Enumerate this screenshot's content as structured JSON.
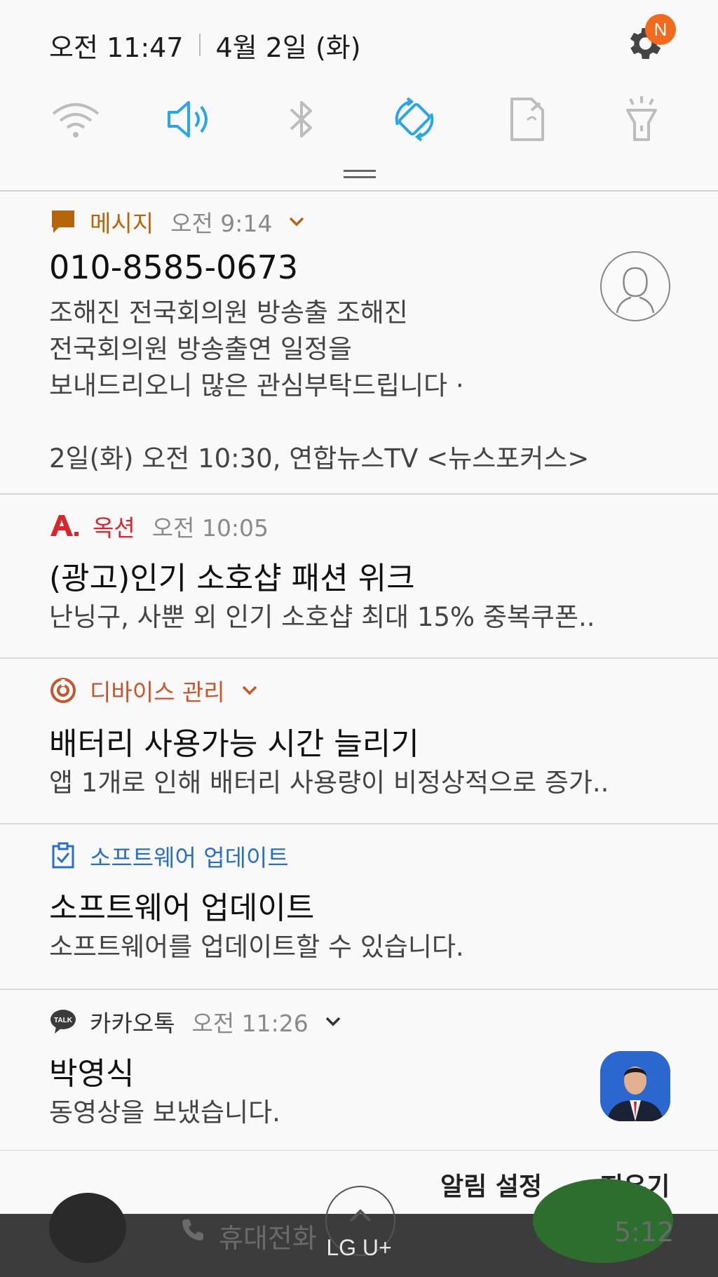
{
  "status_bar": {
    "time": "오전 11:47",
    "date": "4월 2일 (화)",
    "settings_badge": "N"
  },
  "quick_settings": [
    {
      "name": "wifi-icon",
      "state": "off"
    },
    {
      "name": "sound-icon",
      "state": "on"
    },
    {
      "name": "bluetooth-icon",
      "state": "off"
    },
    {
      "name": "auto-rotate-icon",
      "state": "on"
    },
    {
      "name": "nfc-icon",
      "state": "off"
    },
    {
      "name": "flashlight-icon",
      "state": "off"
    }
  ],
  "notifications": {
    "message": {
      "app": "메시지",
      "time": "오전 9:14",
      "title": "010-8585-0673",
      "body": "조해진 전국회의원 방송출 조해진\n전국회의원 방송출연 일정을\n보내드리오니 많은 관심부탁드립니다 ·\n\n2일(화) 오전 10:30, 연합뉴스TV <뉴스포커스>"
    },
    "auction": {
      "app": "옥션",
      "time": "오전 10:05",
      "title": "(광고)인기 소호샵 패션 위크",
      "body": "난닝구, 사뿐 외 인기 소호샵  최대 15% 중복쿠폰.."
    },
    "device": {
      "app": "디바이스 관리",
      "title": "배터리 사용가능 시간 늘리기",
      "body": "앱 1개로 인해 배터리 사용량이 비정상적으로 증가.."
    },
    "software": {
      "app": "소프트웨어 업데이트",
      "title": "소프트웨어 업데이트",
      "body": "소프트웨어를 업데이트할 수 있습니다."
    },
    "kakao": {
      "app": "카카오톡",
      "time": "오전 11:26",
      "title": "박영식",
      "body": "동영상을 보냈습니다."
    }
  },
  "actions": {
    "settings": "알림 설정",
    "clear": "지우기"
  },
  "background": {
    "call_label": "휴대전화",
    "call_time": "5:12",
    "carrier": "LG U+"
  },
  "colors": {
    "accent_blue": "#29a6e6",
    "message_brown": "#b5650b",
    "auction_red": "#d7262e",
    "device_orange": "#c6562c",
    "software_blue": "#2a6fc7"
  }
}
